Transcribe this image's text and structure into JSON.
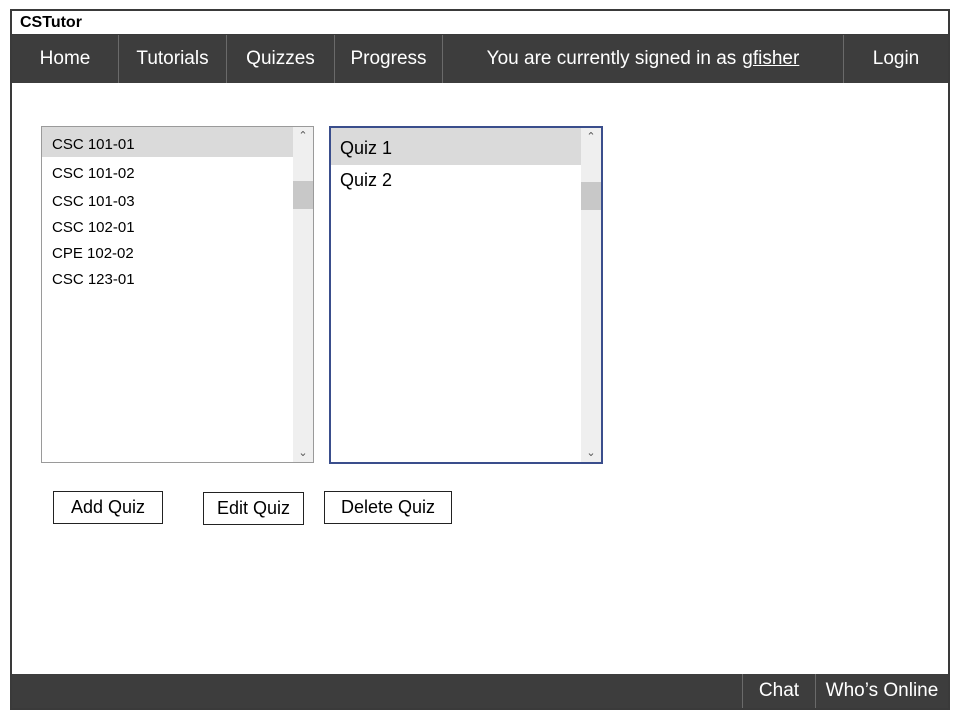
{
  "window": {
    "title": "CSTutor"
  },
  "nav": {
    "home": "Home",
    "tutorials": "Tutorials",
    "quizzes": "Quizzes",
    "progress": "Progress",
    "signed_in_prefix": "You are currently signed in as",
    "username": "gfisher",
    "login": "Login"
  },
  "courses": {
    "items": [
      "CSC 101-01",
      "CSC 101-02",
      "CSC 101-03",
      "CSC 102-01",
      "CPE 102-02",
      "CSC 123-01"
    ],
    "selected": "CSC 101-01"
  },
  "quizzes": {
    "items": [
      "Quiz 1",
      "Quiz 2"
    ],
    "selected": "Quiz 1"
  },
  "actions": {
    "add": "Add Quiz",
    "edit": "Edit Quiz",
    "delete": "Delete Quiz"
  },
  "footer": {
    "chat": "Chat",
    "whos_online": "Who’s Online"
  },
  "icons": {
    "scroll_up": "chevron-up-icon",
    "scroll_down": "chevron-down-icon"
  },
  "colors": {
    "nav_bg": "#3d3d3d",
    "selection": "#dadada",
    "focus_border": "#3a4e8c"
  }
}
